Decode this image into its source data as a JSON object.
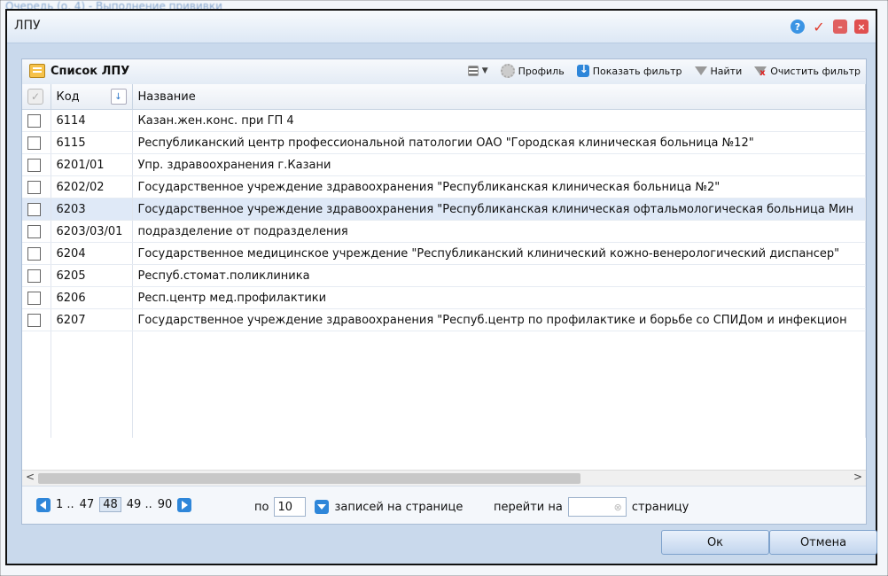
{
  "background": {
    "text": "Очередь (о, 4) - Выполнение прививки"
  },
  "dialog": {
    "title": "ЛПУ"
  },
  "list": {
    "title": "Список ЛПУ",
    "actions": {
      "profile": "Профиль",
      "show_filter": "Показать фильтр",
      "find": "Найти",
      "clear_filter": "Очистить фильтр"
    },
    "columns": {
      "code": "Код",
      "name": "Название"
    },
    "rows": [
      {
        "code": "6114",
        "name": "Казан.жен.конс. при ГП 4"
      },
      {
        "code": "6115",
        "name": "Республиканский центр профессиональной патологии ОАО \"Городская клиническая больница №12\""
      },
      {
        "code": "6201/01",
        "name": "Упр. здравоохранения г.Казани"
      },
      {
        "code": "6202/02",
        "name": "Государственное учреждение здравоохранения \"Республиканская клиническая больница №2\""
      },
      {
        "code": "6203",
        "name": "Государственное учреждение здравоохранения \"Республиканская клиническая офтальмологическая больница Мин"
      },
      {
        "code": "6203/03/01",
        "name": "подразделение от подразделения"
      },
      {
        "code": "6204",
        "name": "Государственное медицинское учреждение \"Республиканский клинический кожно-венерологический диспансер\""
      },
      {
        "code": "6205",
        "name": "Респуб.стомат.поликлиника"
      },
      {
        "code": "6206",
        "name": "Респ.центр мед.профилактики"
      },
      {
        "code": "6207",
        "name": "Государственное учреждение здравоохранения \"Респуб.центр по профилактике и борьбе со СПИДом и инфекцион"
      }
    ],
    "selected_row_index": 4
  },
  "pager": {
    "first": "1 ..",
    "p47": "47",
    "current": "48",
    "p49": "49 ..",
    "last": "90",
    "per_label": "по",
    "per_value": "10",
    "records_label": "записей на странице",
    "goto_label": "перейти на",
    "page_label": "страницу"
  },
  "buttons": {
    "ok": "Ок",
    "cancel": "Отмена"
  },
  "icons": {
    "help": "help-icon",
    "confirm": "checkmark-icon",
    "minimize": "minimize-icon",
    "close": "close-icon",
    "list": "list-icon",
    "columns": "columns-icon",
    "gear": "gear-icon",
    "download": "download-icon",
    "filter": "filter-icon",
    "clear": "clear-filter-icon"
  },
  "colors": {
    "accent": "#2e86d9",
    "selected_row": "#dfe9f7",
    "frame": "#c9d9ec"
  }
}
